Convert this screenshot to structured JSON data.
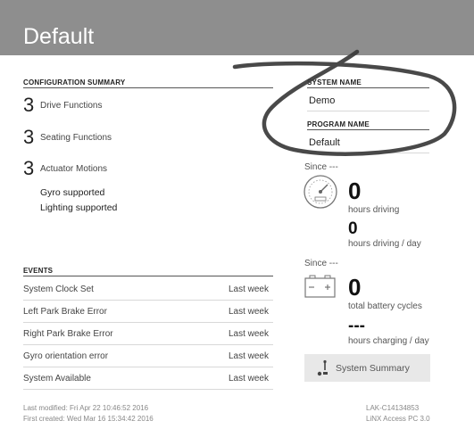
{
  "window": {
    "title": "Default"
  },
  "config": {
    "heading": "CONFIGURATION SUMMARY",
    "items": [
      {
        "count": "3",
        "label": "Drive Functions"
      },
      {
        "count": "3",
        "label": "Seating Functions"
      },
      {
        "count": "3",
        "label": "Actuator Motions"
      }
    ],
    "supports": [
      "Gyro supported",
      "Lighting supported"
    ]
  },
  "system_name": {
    "heading": "SYSTEM NAME",
    "value": "Demo"
  },
  "program_name": {
    "heading": "PROGRAM NAME",
    "value": "Default"
  },
  "events": {
    "heading": "EVENTS",
    "rows": [
      {
        "name": "System Clock Set",
        "time": "Last week"
      },
      {
        "name": "Left Park Brake Error",
        "time": "Last week"
      },
      {
        "name": "Right Park Brake Error",
        "time": "Last week"
      },
      {
        "name": "Gyro orientation error",
        "time": "Last week"
      },
      {
        "name": "System Available",
        "time": "Last week"
      }
    ]
  },
  "driving": {
    "since": "Since ---",
    "hours": "0",
    "hours_label": "hours driving",
    "per_day": "0",
    "per_day_label": "hours driving / day",
    "icon": "speedometer-icon"
  },
  "battery": {
    "since": "Since ---",
    "cycles": "0",
    "cycles_label": "total battery cycles",
    "charging": "---",
    "charging_label": "hours charging / day",
    "icon": "battery-icon"
  },
  "summary_button": {
    "label": "System Summary",
    "icon": "joystick-icon"
  },
  "footer": {
    "last_modified": "Last modified: Fri Apr 22 10:46:52 2016",
    "first_created": "First created: Wed Mar 16 15:34:42 2016",
    "serial": "LAK-C14134853",
    "version": "LiNX Access PC 3.0"
  },
  "colors": {
    "titlebar": "#8e8e8e",
    "scribble": "#3a3a3a",
    "button": "#e8e8e8"
  }
}
